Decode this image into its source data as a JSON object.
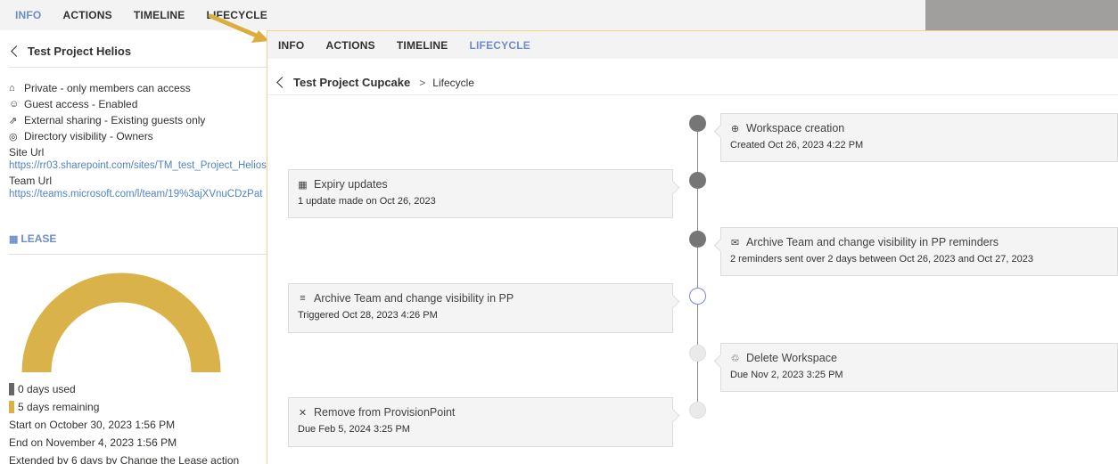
{
  "back_panel": {
    "tabs": [
      {
        "label": "INFO",
        "active": true
      },
      {
        "label": "ACTIONS",
        "active": false
      },
      {
        "label": "TIMELINE",
        "active": false
      },
      {
        "label": "LIFECYCLE",
        "active": false
      }
    ],
    "title": "Test Project Helios",
    "info": [
      {
        "icon": "lock-icon",
        "glyph": "⌂",
        "text": "Private - only members can access"
      },
      {
        "icon": "guest-icon",
        "glyph": "☺",
        "text": "Guest access - Enabled"
      },
      {
        "icon": "share-icon",
        "glyph": "⇗",
        "text": "External sharing - Existing guests only"
      },
      {
        "icon": "visibility-icon",
        "glyph": "◎",
        "text": "Directory visibility - Owners"
      }
    ],
    "site_url_label": "Site Url",
    "site_url": "https://rr03.sharepoint.com/sites/TM_test_Project_Helios",
    "team_url_label": "Team Url",
    "team_url": "https://teams.microsoft.com/l/team/19%3ajXVnuCDzPat",
    "lease_heading": "LEASE",
    "lease": {
      "days_used": 0,
      "days_remaining": 5,
      "used_label": "0 days used",
      "remaining_label": "5 days remaining",
      "used_color": "#666666",
      "remaining_color": "#d9b349"
    },
    "start": "Start on October 30, 2023 1:56 PM",
    "end": "End on November 4, 2023 1:56 PM",
    "extended": "Extended by 6 days by Change the Lease action"
  },
  "panel": {
    "tabs": [
      {
        "label": "INFO",
        "active": false
      },
      {
        "label": "ACTIONS",
        "active": false
      },
      {
        "label": "TIMELINE",
        "active": false
      },
      {
        "label": "LIFECYCLE",
        "active": true
      }
    ],
    "breadcrumb": {
      "current": "Test Project Cupcake",
      "separator": ">",
      "page": "Lifecycle"
    },
    "events": [
      {
        "title": "Workspace creation",
        "desc": "Created Oct 26, 2023 4:22 PM",
        "icon": "plus-circle-icon",
        "glyph": "⊕",
        "state": "done"
      },
      {
        "title": "Expiry updates",
        "desc": "1 update made on Oct 26, 2023",
        "icon": "calendar-icon",
        "glyph": "▦",
        "state": "done"
      },
      {
        "title": "Archive Team and change visibility in PP reminders",
        "desc": "2 reminders sent over 2 days between Oct 26, 2023 and Oct 27, 2023",
        "icon": "reminder-icon",
        "glyph": "✉",
        "state": "done"
      },
      {
        "title": "Archive Team and change visibility in PP",
        "desc": "Triggered Oct 28, 2023 4:26 PM",
        "icon": "archive-icon",
        "glyph": "≡",
        "state": "current"
      },
      {
        "title": "Delete Workspace",
        "desc": "Due Nov 2, 2023 3:25 PM",
        "icon": "trash-icon",
        "glyph": "♲",
        "state": "future"
      },
      {
        "title": "Remove from ProvisionPoint",
        "desc": "Due Feb 5, 2024 3:25 PM",
        "icon": "close-icon",
        "glyph": "✕",
        "state": "future"
      }
    ]
  }
}
